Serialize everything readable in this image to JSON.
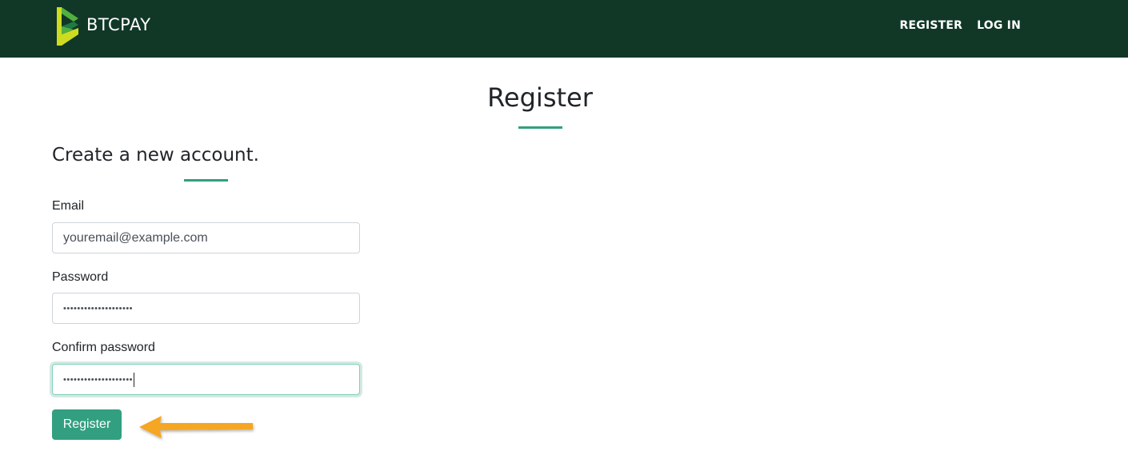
{
  "header": {
    "brand_name": "BTCPAY",
    "nav": [
      {
        "label": "REGISTER"
      },
      {
        "label": "LOG IN"
      }
    ],
    "background_color": "#113826"
  },
  "page": {
    "title": "Register",
    "subtitle": "Create a new account.",
    "accent_color": "#329f80"
  },
  "form": {
    "email": {
      "label": "Email",
      "value": "youremail@example.com"
    },
    "password": {
      "label": "Password",
      "masked_value": "••••••••••••••••••••"
    },
    "confirm_password": {
      "label": "Confirm password",
      "masked_value": "••••••••••••••••••••",
      "focused": true
    },
    "submit_label": "Register"
  },
  "annotation": {
    "arrow_color": "#f5a623",
    "points_to": "register-button"
  }
}
